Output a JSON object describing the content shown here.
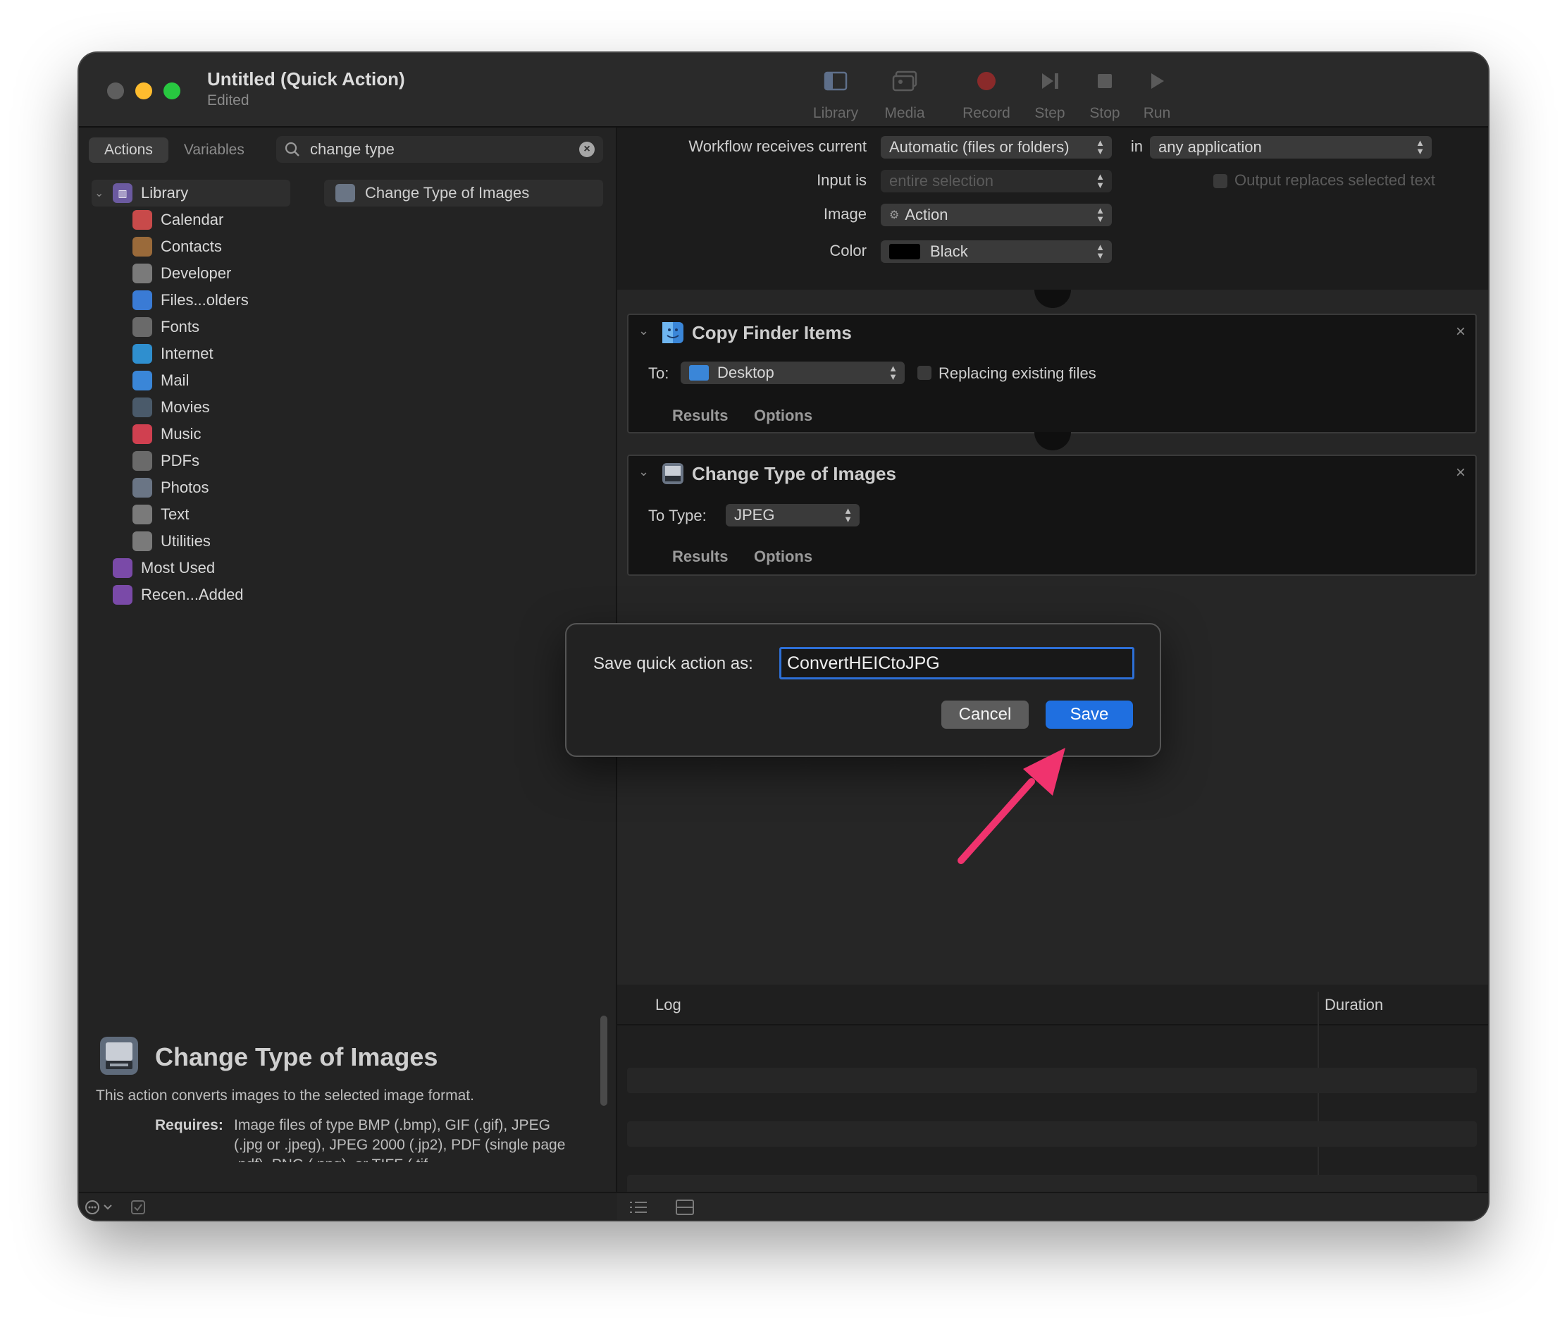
{
  "window": {
    "title": "Untitled (Quick Action)",
    "subtitle": "Edited"
  },
  "toolbar": {
    "library": "Library",
    "media": "Media",
    "record": "Record",
    "step": "Step",
    "stop": "Stop",
    "run": "Run"
  },
  "left": {
    "tabs": [
      "Actions",
      "Variables"
    ],
    "search": {
      "value": "change type"
    },
    "tree": {
      "root": "Library",
      "items": [
        {
          "label": "Calendar",
          "icon": "calendar-icon",
          "color": "#c84a4a"
        },
        {
          "label": "Contacts",
          "icon": "contacts-icon",
          "color": "#9a6a3a"
        },
        {
          "label": "Developer",
          "icon": "tools-icon",
          "color": "#7a7a7a"
        },
        {
          "label": "Files...olders",
          "icon": "finder-icon",
          "color": "#3a7bd5"
        },
        {
          "label": "Fonts",
          "icon": "fonts-icon",
          "color": "#6a6a6a"
        },
        {
          "label": "Internet",
          "icon": "globe-icon",
          "color": "#2f8fcf"
        },
        {
          "label": "Mail",
          "icon": "mail-icon",
          "color": "#3a86d8"
        },
        {
          "label": "Movies",
          "icon": "movies-icon",
          "color": "#4a5a6a"
        },
        {
          "label": "Music",
          "icon": "music-icon",
          "color": "#d04050"
        },
        {
          "label": "PDFs",
          "icon": "pdf-icon",
          "color": "#6a6a6a"
        },
        {
          "label": "Photos",
          "icon": "photos-icon",
          "color": "#6a7585"
        },
        {
          "label": "Text",
          "icon": "text-icon",
          "color": "#7a7a7a"
        },
        {
          "label": "Utilities",
          "icon": "tools-icon",
          "color": "#7a7a7a"
        }
      ],
      "extras": [
        {
          "label": "Most Used",
          "icon": "smart-folder-icon",
          "color": "#7a4aa8"
        },
        {
          "label": "Recen...Added",
          "icon": "smart-folder-icon",
          "color": "#7a4aa8"
        }
      ]
    },
    "actions": [
      "Change Type of Images"
    ],
    "description": {
      "title": "Change Type of Images",
      "text": "This action converts images to the selected image format.",
      "requires_label": "Requires:",
      "requires_text": "Image files of type BMP (.bmp), GIF (.gif), JPEG (.jpg or .jpeg), JPEG 2000 (.jp2), PDF (single page .pdf), PNG (.png), or TIFF (.tif"
    }
  },
  "workflow": {
    "receives_label": "Workflow receives current",
    "receives_value": "Automatic (files or folders)",
    "in_label": "in",
    "app_value": "any application",
    "input_label": "Input is",
    "input_value": "entire selection",
    "output_label": "Output replaces selected text",
    "image_label": "Image",
    "image_value": "Action",
    "color_label": "Color",
    "color_value": "Black"
  },
  "actions": {
    "copy": {
      "title": "Copy Finder Items",
      "to_label": "To:",
      "to_value": "Desktop",
      "replace_label": "Replacing existing files",
      "results": "Results",
      "options": "Options"
    },
    "change": {
      "title": "Change Type of Images",
      "type_label": "To Type:",
      "type_value": "JPEG",
      "results": "Results",
      "options": "Options"
    }
  },
  "log": {
    "col1": "Log",
    "col2": "Duration"
  },
  "dialog": {
    "label": "Save quick action as:",
    "value": "ConvertHEICtoJPG",
    "cancel": "Cancel",
    "save": "Save"
  },
  "colors": {
    "accent": "#1f6fe0",
    "arrow": "#f0336e"
  }
}
